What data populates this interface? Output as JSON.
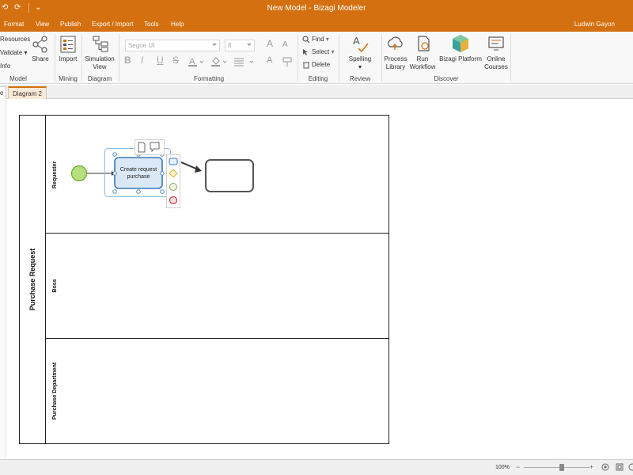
{
  "window": {
    "title": "New Model - Bizagi Modeler",
    "quick_access": [
      "⟲",
      "⟳",
      "⌄"
    ]
  },
  "menu": {
    "items": [
      "Format",
      "View",
      "Publish",
      "Export / Import",
      "Tools",
      "Help"
    ],
    "user": "Ludwin Gayon"
  },
  "ribbon": {
    "model": {
      "label": "Model",
      "resources": "Resources",
      "validate": "Validate",
      "info": "Info",
      "share": "Share"
    },
    "mining": {
      "label": "Mining",
      "import": "Import"
    },
    "diagram": {
      "label": "Diagram",
      "simulation_view": "Simulation View"
    },
    "formatting": {
      "label": "Formatting",
      "font": "Segoe UI",
      "size": "8",
      "bold": "B",
      "italic": "I",
      "underline": "U",
      "strike": "S"
    },
    "editing": {
      "label": "Editing",
      "find": "Find",
      "select": "Select",
      "delete": "Delete"
    },
    "review": {
      "label": "Review",
      "spelling": "Spelling"
    },
    "discover": {
      "label": "Discover",
      "process_library": "Process Library",
      "run_workflow": "Run Workflow",
      "bizagi_platform": "Bizagi Platform",
      "online_courses": "Online Courses"
    }
  },
  "tabs": [
    "e",
    "Diagram 2"
  ],
  "diagram": {
    "pool_name": "Purchase Request",
    "lanes": [
      "Requester",
      "Boss",
      "Purchase Department"
    ],
    "task_label": "Create request purchase",
    "task_label_lines": [
      "Create request",
      "purchase"
    ]
  },
  "status": {
    "zoom": "100%",
    "zoom_level": 0.58
  },
  "colors": {
    "accent": "#d4700f",
    "start_event": "#b5e07a",
    "task_fill": "#dbe9f6",
    "task_border": "#3a78b8"
  }
}
